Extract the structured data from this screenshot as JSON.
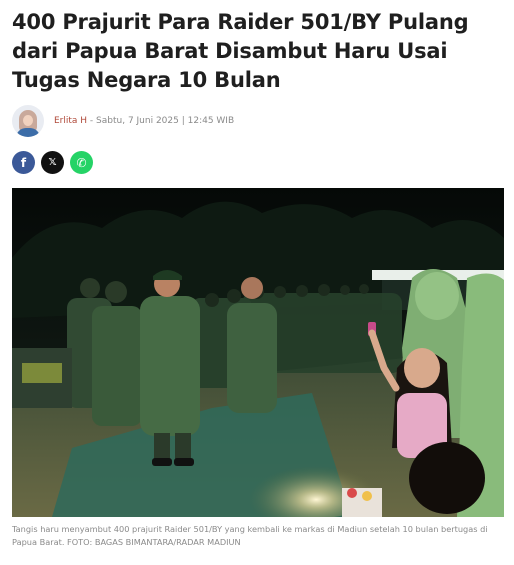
{
  "article": {
    "title": "400 Prajurit Para Raider 501/BY Pulang dari Papua Barat Disambut Haru Usai Tugas Negara 10 Bulan",
    "author": "Erlita H",
    "date_separator": " - ",
    "date": "Sabtu, 7 Juni 2025 | 12:45 WIB",
    "caption": "Tangis haru menyambut 400 prajurit Raider 501/BY yang kembali ke markas di Madiun setelah 10 bulan bertugas di Papua Barat. FOTO: BAGAS BIMANTARA/RADAR MADIUN"
  },
  "share": {
    "facebook_glyph": "f",
    "x_glyph": "𝕏",
    "whatsapp_glyph": "✆",
    "icons": [
      "facebook-icon",
      "x-icon",
      "whatsapp-icon"
    ],
    "colors": {
      "facebook": "#3b5998",
      "x": "#111111",
      "whatsapp": "#25d366"
    }
  },
  "photo": {
    "subject": "soldiers-in-camouflage-welcomed-at-night"
  },
  "colors": {
    "headline": "#1f1f1f",
    "author": "#b04a3a",
    "meta": "#8a8a8a"
  }
}
